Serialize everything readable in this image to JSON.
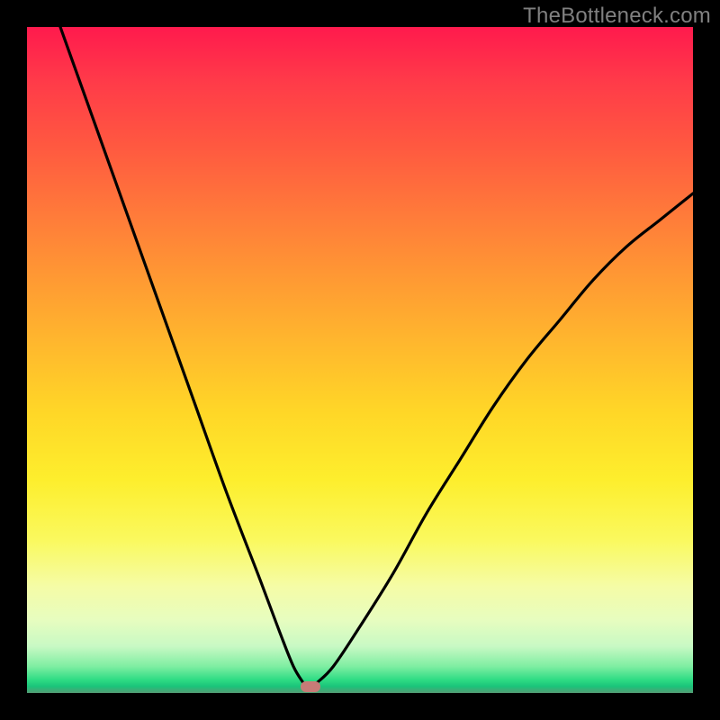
{
  "watermark": "TheBottleneck.com",
  "colors": {
    "frame": "#000000",
    "curve": "#000000",
    "marker": "#c77b77",
    "gradient_top": "#ff1a4d",
    "gradient_bottom": "#559c74"
  },
  "chart_data": {
    "type": "line",
    "title": "",
    "xlabel": "",
    "ylabel": "",
    "xlim": [
      0,
      100
    ],
    "ylim": [
      0,
      100
    ],
    "annotations": [
      {
        "type": "marker",
        "x": 42.5,
        "y": 1.0,
        "shape": "rounded-rect"
      }
    ],
    "series": [
      {
        "name": "left-branch",
        "x": [
          5,
          10,
          15,
          20,
          25,
          30,
          35,
          38,
          40,
          41.5
        ],
        "y": [
          100,
          86,
          72,
          58,
          44,
          30,
          17,
          9,
          4,
          1.5
        ]
      },
      {
        "name": "right-branch",
        "x": [
          43.5,
          46,
          50,
          55,
          60,
          65,
          70,
          75,
          80,
          85,
          90,
          95,
          100
        ],
        "y": [
          1.5,
          4,
          10,
          18,
          27,
          35,
          43,
          50,
          56,
          62,
          67,
          71,
          75
        ]
      }
    ]
  }
}
